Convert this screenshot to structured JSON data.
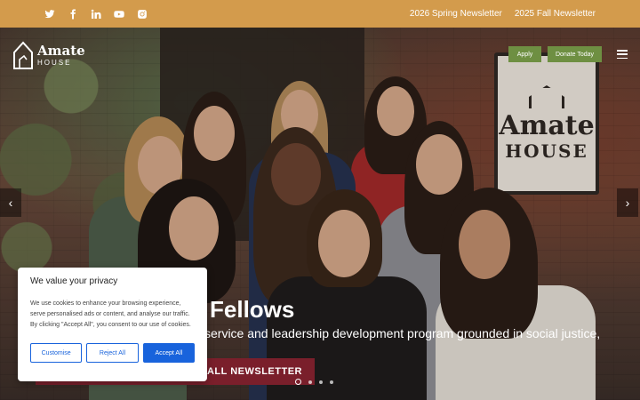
{
  "social": {
    "icons": [
      "twitter-icon",
      "facebook-icon",
      "linkedin-icon",
      "youtube-icon",
      "instagram-icon"
    ]
  },
  "toplinks": {
    "spring": "2026 Spring Newsletter",
    "fall": "2025 Fall Newsletter"
  },
  "logo": {
    "line1": "Amate",
    "line2": "HOUSE"
  },
  "sign": {
    "line1": "Amate",
    "line2": "HOUSE"
  },
  "header": {
    "apply": "Apply",
    "donate": "Donate Today"
  },
  "hero": {
    "title": "Fellows",
    "subtitle": "service and leadership development program grounded in social justice,",
    "newsletter_button": "UR FALL NEWSLETTER",
    "slide_count": 4,
    "active_slide": 1
  },
  "cookie": {
    "title": "We value your privacy",
    "body": "We use cookies to enhance your browsing experience, serve personalised ads or content, and analyse our traffic. By clicking \"Accept All\", you consent to our use of cookies.",
    "customise": "Customise",
    "reject": "Reject All",
    "accept": "Accept All"
  },
  "colors": {
    "topbar": "#d39b4c",
    "accent_green": "#6e8f42",
    "newsletter_red": "#7a1f2b",
    "cookie_blue": "#1863dc"
  }
}
